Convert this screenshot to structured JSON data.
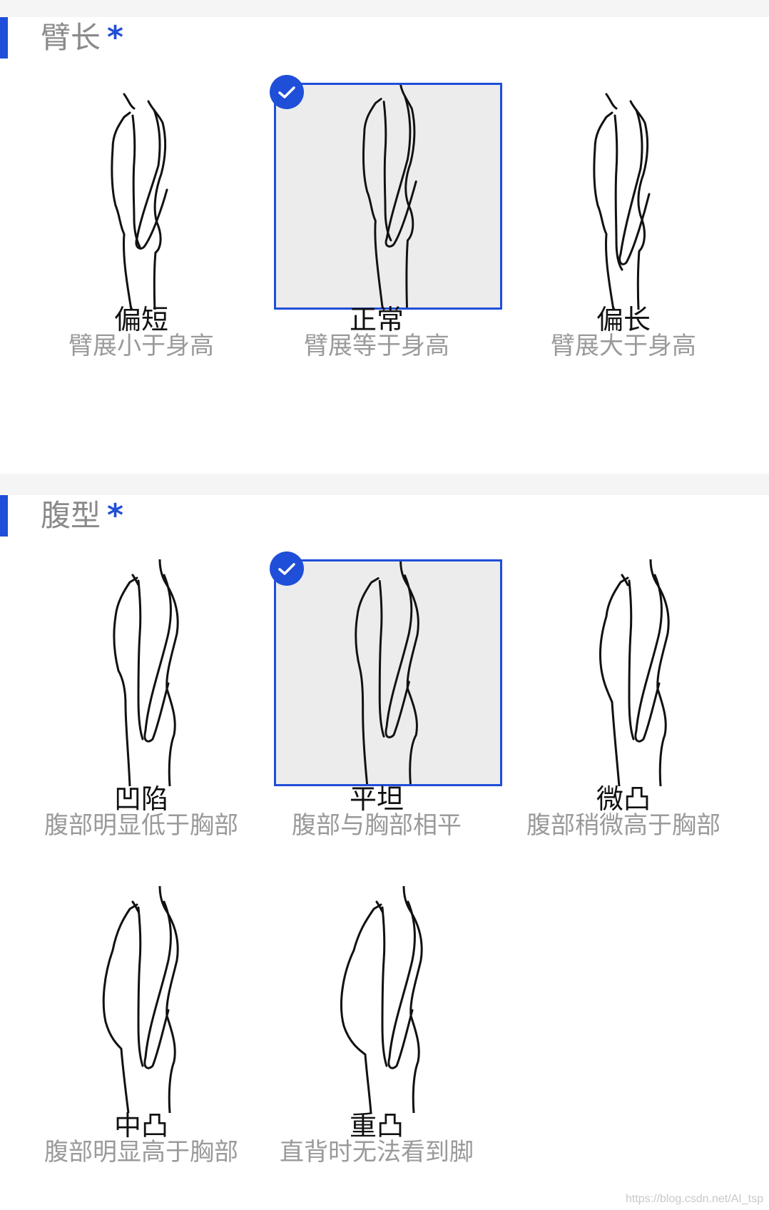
{
  "sections": [
    {
      "title": "臂长",
      "required_mark": "*",
      "options": [
        {
          "title": "偏短",
          "desc": "臂展小于身高",
          "selected": false,
          "icon": "arm-short-figure-icon"
        },
        {
          "title": "正常",
          "desc": "臂展等于身高",
          "selected": true,
          "icon": "arm-normal-figure-icon"
        },
        {
          "title": "偏长",
          "desc": "臂展大于身高",
          "selected": false,
          "icon": "arm-long-figure-icon"
        }
      ]
    },
    {
      "title": "腹型",
      "required_mark": "*",
      "options": [
        {
          "title": "凹陷",
          "desc": "腹部明显低于胸部",
          "selected": false,
          "icon": "belly-sunken-figure-icon"
        },
        {
          "title": "平坦",
          "desc": "腹部与胸部相平",
          "selected": true,
          "icon": "belly-flat-figure-icon"
        },
        {
          "title": "微凸",
          "desc": "腹部稍微高于胸部",
          "selected": false,
          "icon": "belly-slight-figure-icon"
        },
        {
          "title": "中凸",
          "desc": "腹部明显高于胸部",
          "selected": false,
          "icon": "belly-medium-figure-icon"
        },
        {
          "title": "重凸",
          "desc": "直背时无法看到脚",
          "selected": false,
          "icon": "belly-heavy-figure-icon"
        }
      ]
    }
  ],
  "colors": {
    "accent": "#1f4ed8",
    "selected_bg": "#ececec",
    "gap": "#f5f5f5"
  },
  "watermark": "https://blog.csdn.net/AI_tsp"
}
